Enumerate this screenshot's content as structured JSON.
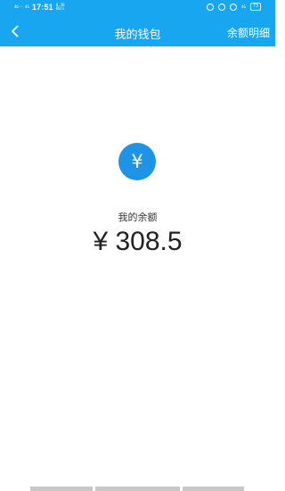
{
  "status_bar": {
    "left_top": "4G⁺⁺ 4G",
    "time": "17:51",
    "speed_value": "0.30",
    "speed_unit": "KB/s",
    "network": "4G",
    "battery": "73"
  },
  "nav": {
    "title": "我的钱包",
    "action": "余额明细",
    "back_icon": "chevron-left-icon"
  },
  "wallet": {
    "icon_symbol": "¥",
    "label": "我的余额",
    "amount": "¥ 308.5"
  }
}
